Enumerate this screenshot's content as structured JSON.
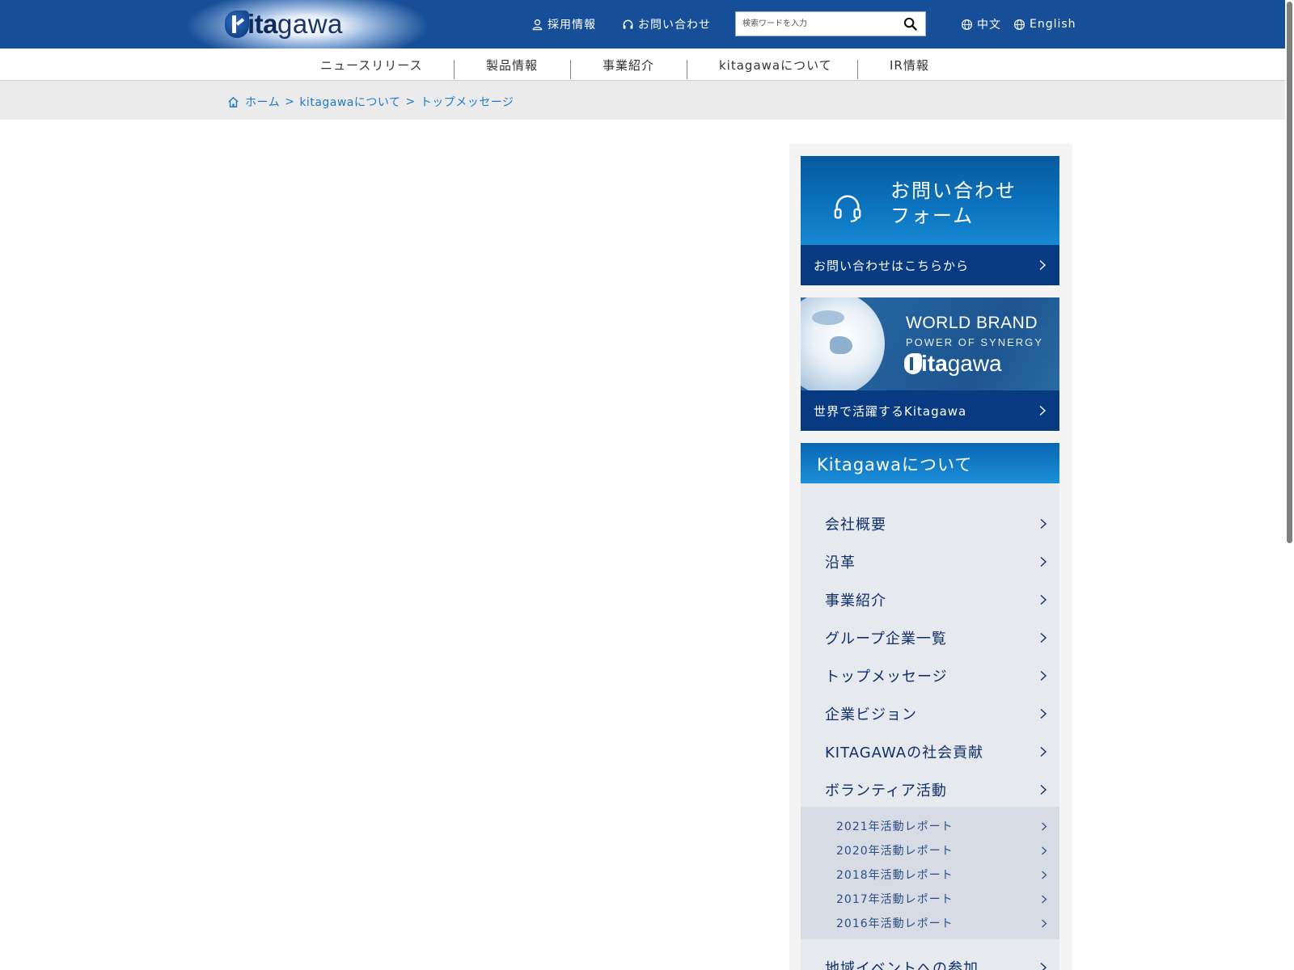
{
  "header": {
    "logo_ita": "ita",
    "logo_gawa": "gawa",
    "links": {
      "careers": "採用情報",
      "contact": "お問い合わせ",
      "chinese": "中文",
      "english": "English"
    },
    "search_placeholder": "検索ワードを入力"
  },
  "nav": [
    "ニュースリリース",
    "製品情報",
    "事業紹介",
    "kitagawaについて",
    "IR情報"
  ],
  "breadcrumb": {
    "home": "ホーム",
    "separator": ">",
    "parent": "kitagawaについて",
    "current": "トップメッセージ"
  },
  "sidebar": {
    "contact_card": {
      "title_line1": "お問い合わせ",
      "title_line2": "フォーム",
      "link": "お問い合わせはこちらから"
    },
    "brand_card": {
      "line1": "WORLD BRAND",
      "line2": "POWER OF SYNERGY",
      "logo_ita": "ita",
      "logo_gawa": "gawa",
      "link": "世界で活躍するKitagawa"
    },
    "about_title": "Kitagawaについて",
    "menu": [
      "会社概要",
      "沿革",
      "事業紹介",
      "グループ企業一覧",
      "トップメッセージ",
      "企業ビジョン",
      "KITAGAWAの社会貢献",
      "ボランティア活動"
    ],
    "submenu": [
      "2021年活動レポート",
      "2020年活動レポート",
      "2018年活動レポート",
      "2017年活動レポート",
      "2016年活動レポート"
    ],
    "menu_after": [
      "地域イベントへの参加"
    ]
  },
  "colors": {
    "header_blue": "#164f97",
    "card_navy": "#083a82",
    "link_blue": "#1f79c9",
    "menu_text": "#0f2f6b"
  }
}
